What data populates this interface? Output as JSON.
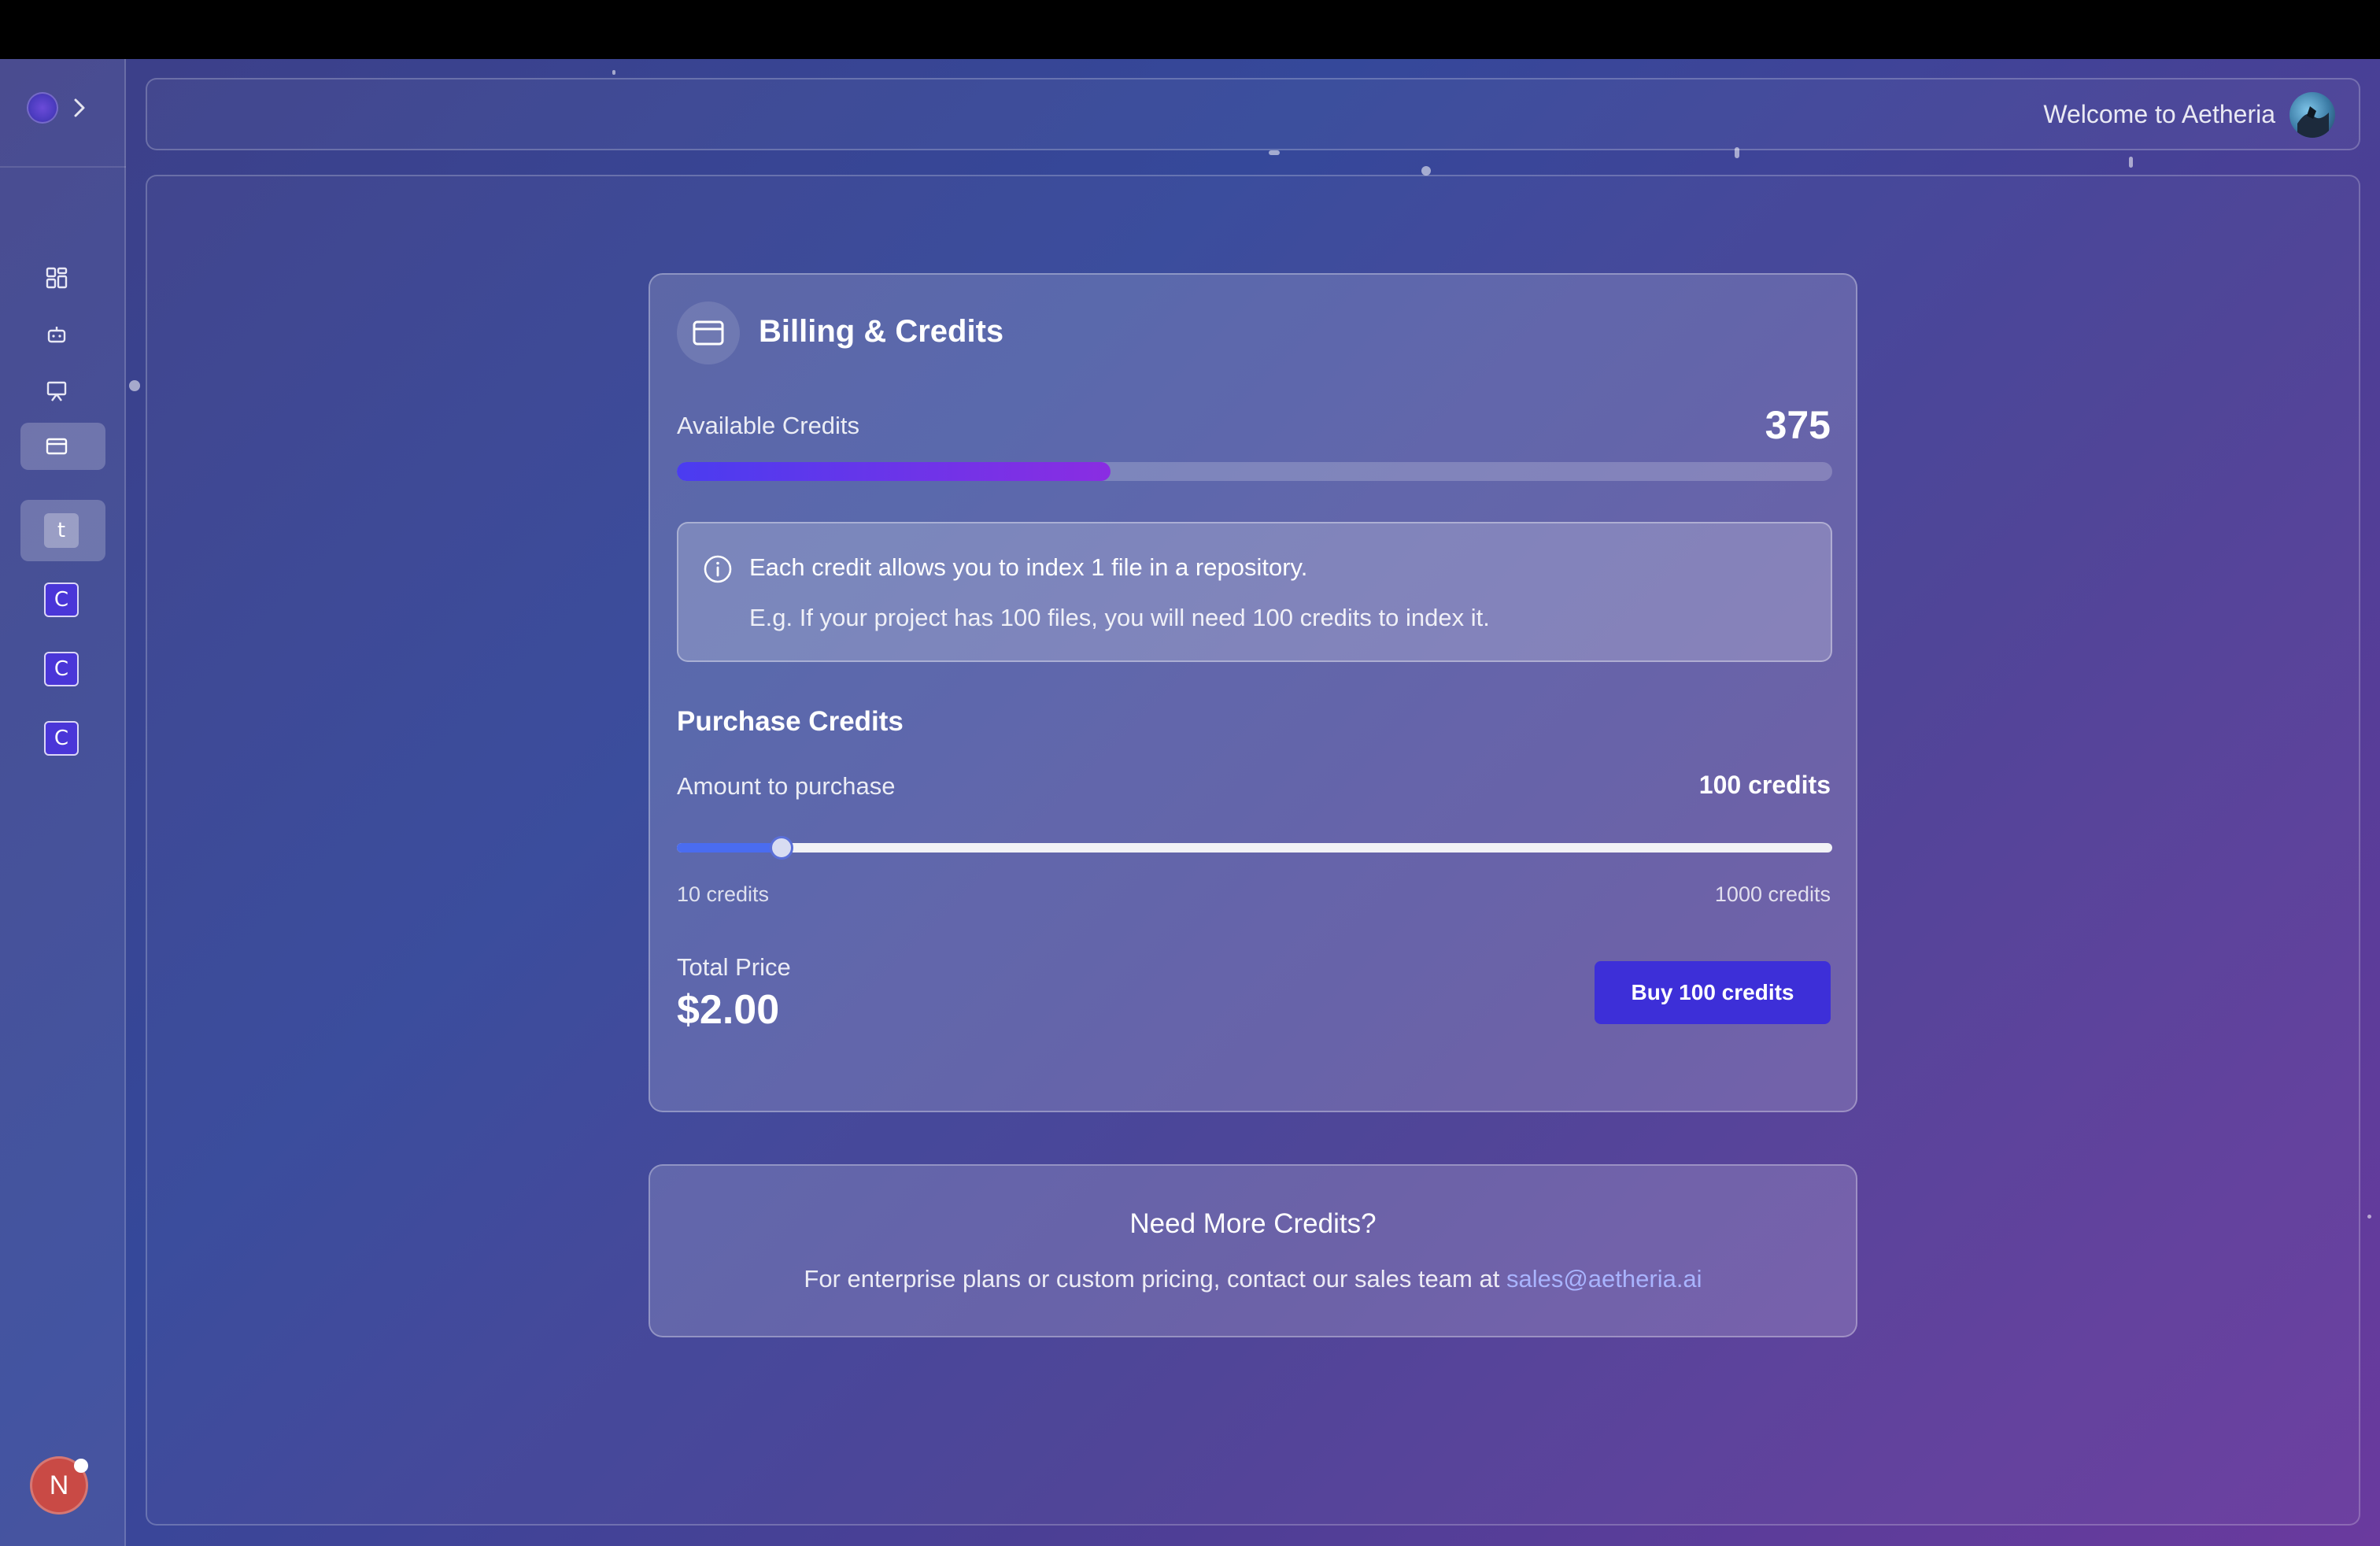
{
  "topbar": {
    "welcome": "Welcome to Aetheria"
  },
  "sidebar": {
    "nav_icons": [
      "dashboard-grid-icon",
      "bot-icon",
      "presentation-icon",
      "credit-card-icon"
    ],
    "active_nav": "credit-card-icon",
    "workspaces": [
      {
        "letter": "t",
        "active": true
      },
      {
        "letter": "C",
        "active": false
      },
      {
        "letter": "C",
        "active": false
      },
      {
        "letter": "C",
        "active": false
      }
    ],
    "user_initial": "N"
  },
  "billing": {
    "title": "Billing & Credits",
    "available_label": "Available Credits",
    "available_value": "375",
    "available_fraction": 0.375,
    "info_line1": "Each credit allows you to index 1 file in a repository.",
    "info_line2": "E.g. If your project has 100 files, you will need 100 credits to index it.",
    "purchase_title": "Purchase Credits",
    "amount_label": "Amount to purchase",
    "amount_value": "100 credits",
    "slider": {
      "min": 10,
      "max": 1000,
      "value": 100
    },
    "slider_min_label": "10 credits",
    "slider_max_label": "1000 credits",
    "total_label": "Total Price",
    "total_value": "$2.00",
    "buy_label": "Buy 100 credits"
  },
  "more_credits": {
    "title": "Need More Credits?",
    "text": "For enterprise plans or custom pricing, contact our sales team at",
    "email": "sales@aetheria.ai"
  },
  "colors": {
    "accent": "#3d2fd8",
    "progress_start": "#4a3cf0",
    "progress_end": "#8a2de2",
    "link": "#a9b4ff",
    "avatar": "#c94a45"
  }
}
